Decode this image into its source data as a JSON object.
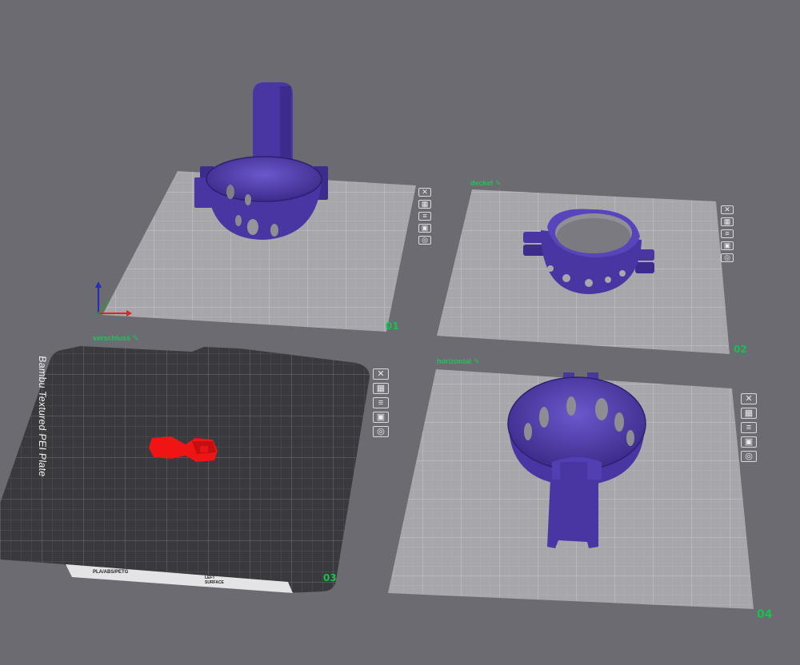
{
  "plates": [
    {
      "number": "01",
      "name": ""
    },
    {
      "number": "02",
      "name": "deckel"
    },
    {
      "number": "03",
      "name": "verschluss"
    },
    {
      "number": "04",
      "name": "horizontal"
    }
  ],
  "edit_glyph": "✎",
  "plate_tools": [
    "close-icon",
    "arrange-icon",
    "settings-icon",
    "lock-icon",
    "orient-icon"
  ],
  "textured_plate": {
    "label": "Bambu Textured PEI Plate",
    "footer_material": "PLA/ABS/PETG",
    "footer_surface_line1": "LEFT",
    "footer_surface_line2": "SURFACE"
  },
  "colors": {
    "background": "#6b6b71",
    "plate_light": "#a6a6ab",
    "plate_dark": "#3a3a3e",
    "model_purple": "#4a36a3",
    "model_red": "#f01414",
    "label_green": "#21c45a"
  }
}
